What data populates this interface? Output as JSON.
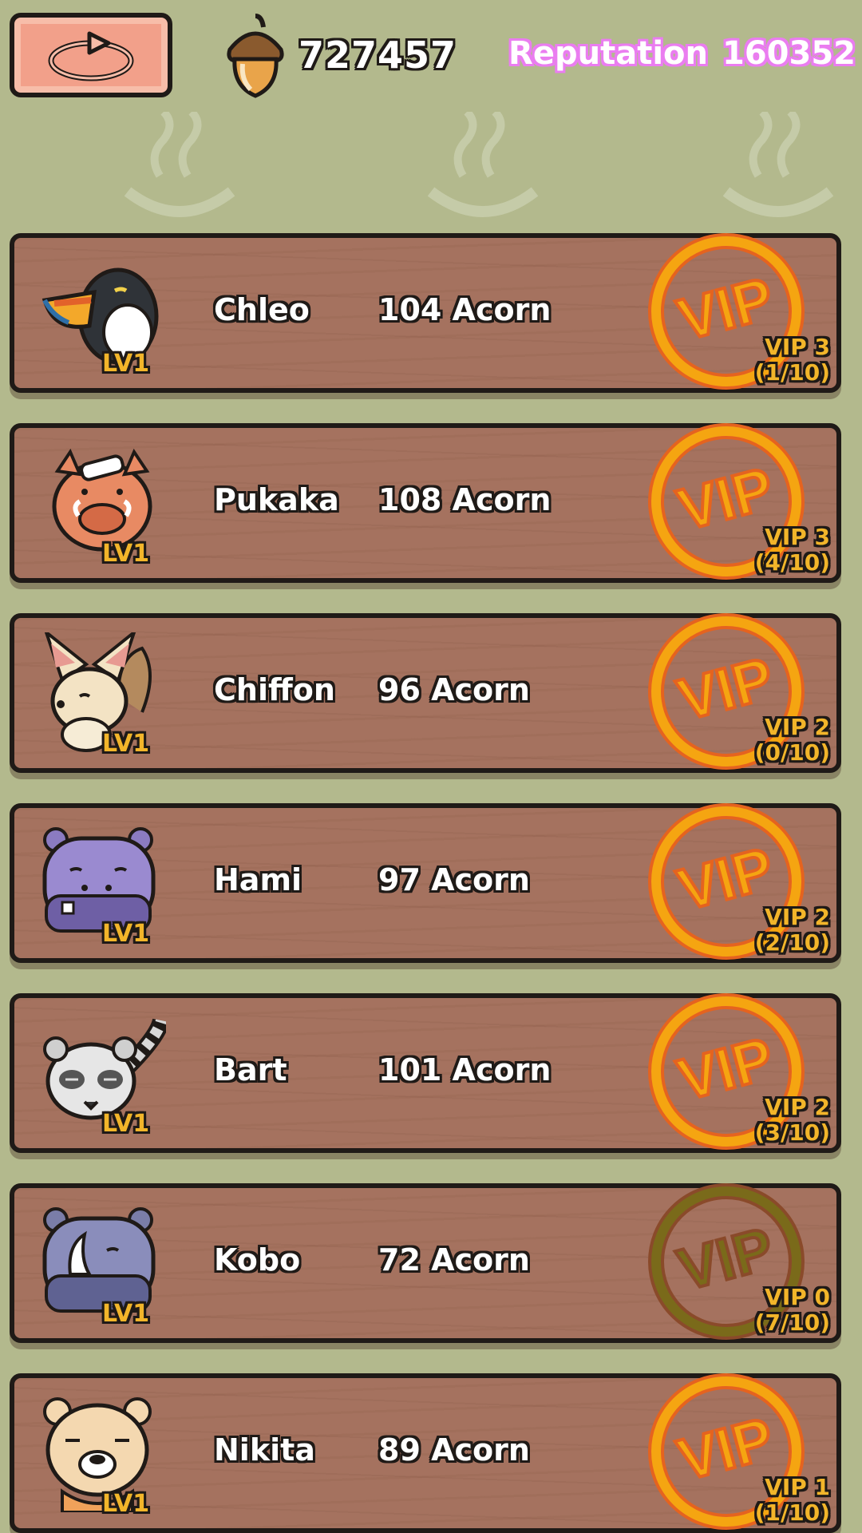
{
  "header": {
    "back_icon": "return-arrow-icon",
    "acorn_icon": "acorn-icon",
    "acorn_count": "727457",
    "reputation_label": "Reputation",
    "reputation_value": "160352"
  },
  "colors": {
    "background": "#b3b98d",
    "plank": "#a5725f",
    "vip_active": "#f5a511",
    "vip_inactive": "#7a6a1a",
    "reputation_outline": "#ea7df0",
    "level_text": "#f2b52a"
  },
  "guests": [
    {
      "name": "Chleo",
      "price": "104 Acorn",
      "level": "LV1",
      "vip_level": "VIP 3",
      "vip_progress": "(1/10)",
      "vip_active": true,
      "animal": "toucan"
    },
    {
      "name": "Pukaka",
      "price": "108 Acorn",
      "level": "LV1",
      "vip_level": "VIP 3",
      "vip_progress": "(4/10)",
      "vip_active": true,
      "animal": "boar"
    },
    {
      "name": "Chiffon",
      "price": "96 Acorn",
      "level": "LV1",
      "vip_level": "VIP 2",
      "vip_progress": "(0/10)",
      "vip_active": true,
      "animal": "fennec"
    },
    {
      "name": "Hami",
      "price": "97 Acorn",
      "level": "LV1",
      "vip_level": "VIP 2",
      "vip_progress": "(2/10)",
      "vip_active": true,
      "animal": "hippo"
    },
    {
      "name": "Bart",
      "price": "101 Acorn",
      "level": "LV1",
      "vip_level": "VIP 2",
      "vip_progress": "(3/10)",
      "vip_active": true,
      "animal": "lemur"
    },
    {
      "name": "Kobo",
      "price": "72 Acorn",
      "level": "LV1",
      "vip_level": "VIP 0",
      "vip_progress": "(7/10)",
      "vip_active": false,
      "animal": "rhino"
    },
    {
      "name": "Nikita",
      "price": "89 Acorn",
      "level": "LV1",
      "vip_level": "VIP 1",
      "vip_progress": "(1/10)",
      "vip_active": true,
      "animal": "bear"
    }
  ]
}
